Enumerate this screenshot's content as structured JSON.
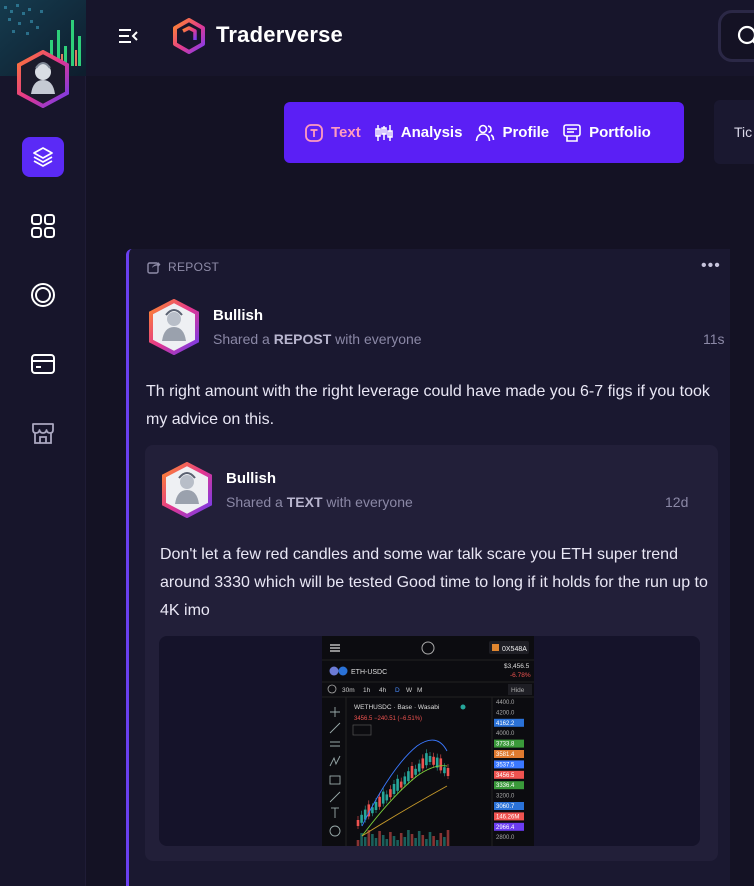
{
  "app": {
    "title": "Traderverse"
  },
  "sidebar": {
    "items": [
      "layers-icon",
      "grid-icon",
      "circle-icon",
      "card-icon",
      "shop-icon"
    ]
  },
  "tabs": [
    {
      "label": "Text",
      "icon": "text-icon",
      "active": true
    },
    {
      "label": "Analysis",
      "icon": "candles-icon"
    },
    {
      "label": "Profile",
      "icon": "users-icon"
    },
    {
      "label": "Portfolio",
      "icon": "portfolio-icon"
    }
  ],
  "right_card": {
    "label": "Tic"
  },
  "post": {
    "repost_label": "REPOST",
    "user": "Bullish",
    "shared_prefix": "Shared a ",
    "shared_type": "REPOST",
    "shared_suffix": " with everyone",
    "time": "11s",
    "text": "Th right amount with the right leverage could have made you 6-7 figs if you took my advice on this.",
    "quoted": {
      "user": "Bullish",
      "shared_prefix": "Shared a ",
      "shared_type": "TEXT",
      "shared_suffix": " with everyone",
      "time": "12d",
      "text": "Don't let a few red candles and some war talk scare you ETH super trend around 3330 which will be tested Good time to long if it holds for the run up to 4K imo",
      "image": {
        "account": "0X548A",
        "pair": "ETH-USDC",
        "price": "$3,456.5",
        "change": "-6.78%",
        "timeframes": [
          "30m",
          "1h",
          "4h",
          "D",
          "W",
          "M"
        ],
        "hide": "Hide",
        "market": "WETHUSDC · Base · Wasabi",
        "ohlc": "3456.5 −240.51 (−6.51%)",
        "price_levels": [
          "4400.0",
          "4200.0",
          "4162.2",
          "4000.0",
          "3733.8",
          "3581.4",
          "3537.5",
          "3456.5",
          "3336.4",
          "3200.0",
          "3060.7",
          "146.26M",
          "2966.4",
          "2800.0"
        ],
        "colors": {
          "up": "#26a69a",
          "down": "#ef5350"
        }
      }
    }
  }
}
